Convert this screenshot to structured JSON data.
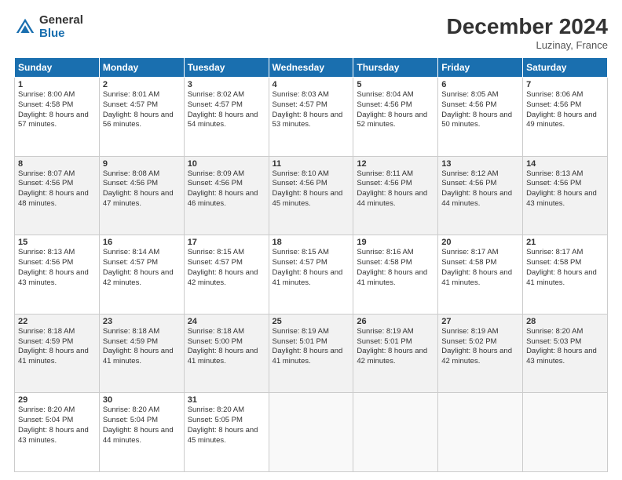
{
  "logo": {
    "general": "General",
    "blue": "Blue"
  },
  "header": {
    "month": "December 2024",
    "location": "Luzinay, France"
  },
  "weekdays": [
    "Sunday",
    "Monday",
    "Tuesday",
    "Wednesday",
    "Thursday",
    "Friday",
    "Saturday"
  ],
  "weeks": [
    [
      {
        "day": "1",
        "sunrise": "8:00 AM",
        "sunset": "4:58 PM",
        "daylight": "8 hours and 57 minutes."
      },
      {
        "day": "2",
        "sunrise": "8:01 AM",
        "sunset": "4:57 PM",
        "daylight": "8 hours and 56 minutes."
      },
      {
        "day": "3",
        "sunrise": "8:02 AM",
        "sunset": "4:57 PM",
        "daylight": "8 hours and 54 minutes."
      },
      {
        "day": "4",
        "sunrise": "8:03 AM",
        "sunset": "4:57 PM",
        "daylight": "8 hours and 53 minutes."
      },
      {
        "day": "5",
        "sunrise": "8:04 AM",
        "sunset": "4:56 PM",
        "daylight": "8 hours and 52 minutes."
      },
      {
        "day": "6",
        "sunrise": "8:05 AM",
        "sunset": "4:56 PM",
        "daylight": "8 hours and 50 minutes."
      },
      {
        "day": "7",
        "sunrise": "8:06 AM",
        "sunset": "4:56 PM",
        "daylight": "8 hours and 49 minutes."
      }
    ],
    [
      {
        "day": "8",
        "sunrise": "8:07 AM",
        "sunset": "4:56 PM",
        "daylight": "8 hours and 48 minutes."
      },
      {
        "day": "9",
        "sunrise": "8:08 AM",
        "sunset": "4:56 PM",
        "daylight": "8 hours and 47 minutes."
      },
      {
        "day": "10",
        "sunrise": "8:09 AM",
        "sunset": "4:56 PM",
        "daylight": "8 hours and 46 minutes."
      },
      {
        "day": "11",
        "sunrise": "8:10 AM",
        "sunset": "4:56 PM",
        "daylight": "8 hours and 45 minutes."
      },
      {
        "day": "12",
        "sunrise": "8:11 AM",
        "sunset": "4:56 PM",
        "daylight": "8 hours and 44 minutes."
      },
      {
        "day": "13",
        "sunrise": "8:12 AM",
        "sunset": "4:56 PM",
        "daylight": "8 hours and 44 minutes."
      },
      {
        "day": "14",
        "sunrise": "8:13 AM",
        "sunset": "4:56 PM",
        "daylight": "8 hours and 43 minutes."
      }
    ],
    [
      {
        "day": "15",
        "sunrise": "8:13 AM",
        "sunset": "4:56 PM",
        "daylight": "8 hours and 43 minutes."
      },
      {
        "day": "16",
        "sunrise": "8:14 AM",
        "sunset": "4:57 PM",
        "daylight": "8 hours and 42 minutes."
      },
      {
        "day": "17",
        "sunrise": "8:15 AM",
        "sunset": "4:57 PM",
        "daylight": "8 hours and 42 minutes."
      },
      {
        "day": "18",
        "sunrise": "8:15 AM",
        "sunset": "4:57 PM",
        "daylight": "8 hours and 41 minutes."
      },
      {
        "day": "19",
        "sunrise": "8:16 AM",
        "sunset": "4:58 PM",
        "daylight": "8 hours and 41 minutes."
      },
      {
        "day": "20",
        "sunrise": "8:17 AM",
        "sunset": "4:58 PM",
        "daylight": "8 hours and 41 minutes."
      },
      {
        "day": "21",
        "sunrise": "8:17 AM",
        "sunset": "4:58 PM",
        "daylight": "8 hours and 41 minutes."
      }
    ],
    [
      {
        "day": "22",
        "sunrise": "8:18 AM",
        "sunset": "4:59 PM",
        "daylight": "8 hours and 41 minutes."
      },
      {
        "day": "23",
        "sunrise": "8:18 AM",
        "sunset": "4:59 PM",
        "daylight": "8 hours and 41 minutes."
      },
      {
        "day": "24",
        "sunrise": "8:18 AM",
        "sunset": "5:00 PM",
        "daylight": "8 hours and 41 minutes."
      },
      {
        "day": "25",
        "sunrise": "8:19 AM",
        "sunset": "5:01 PM",
        "daylight": "8 hours and 41 minutes."
      },
      {
        "day": "26",
        "sunrise": "8:19 AM",
        "sunset": "5:01 PM",
        "daylight": "8 hours and 42 minutes."
      },
      {
        "day": "27",
        "sunrise": "8:19 AM",
        "sunset": "5:02 PM",
        "daylight": "8 hours and 42 minutes."
      },
      {
        "day": "28",
        "sunrise": "8:20 AM",
        "sunset": "5:03 PM",
        "daylight": "8 hours and 43 minutes."
      }
    ],
    [
      {
        "day": "29",
        "sunrise": "8:20 AM",
        "sunset": "5:04 PM",
        "daylight": "8 hours and 43 minutes."
      },
      {
        "day": "30",
        "sunrise": "8:20 AM",
        "sunset": "5:04 PM",
        "daylight": "8 hours and 44 minutes."
      },
      {
        "day": "31",
        "sunrise": "8:20 AM",
        "sunset": "5:05 PM",
        "daylight": "8 hours and 45 minutes."
      },
      null,
      null,
      null,
      null
    ]
  ]
}
